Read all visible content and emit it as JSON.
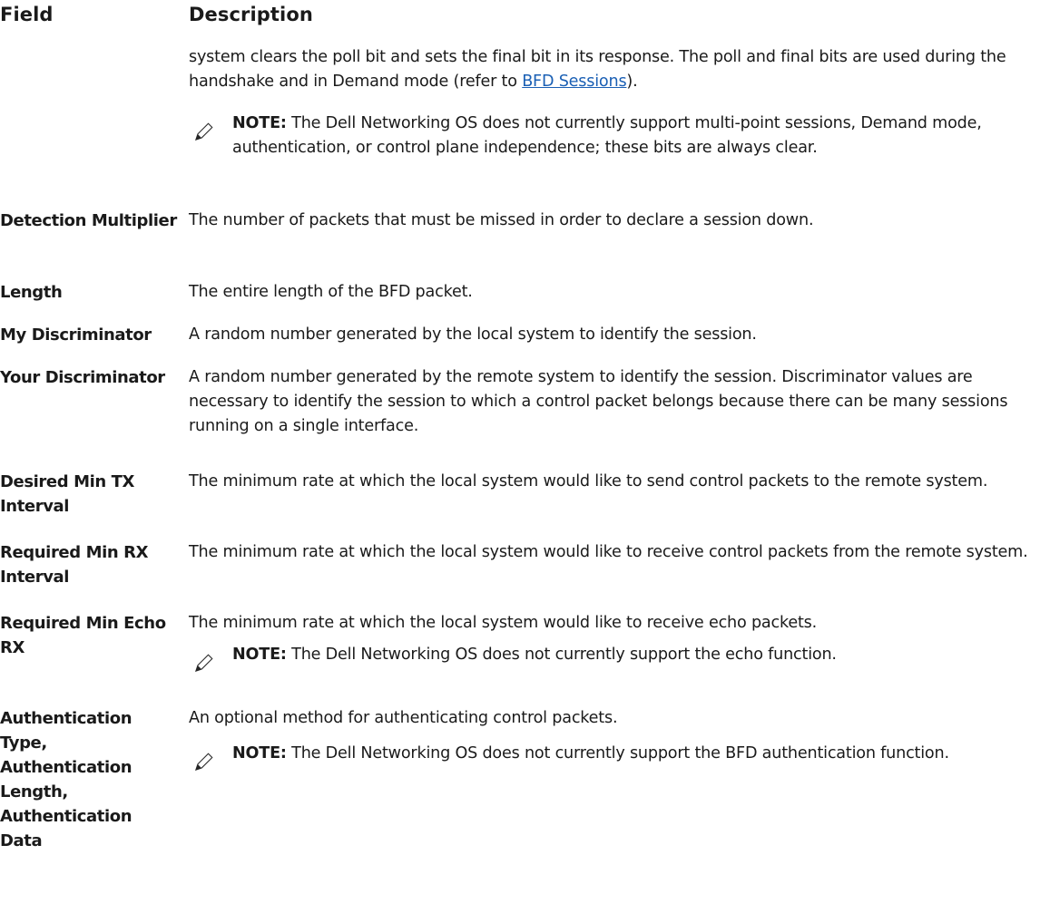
{
  "header": {
    "field": "Field",
    "description": "Description"
  },
  "intro": {
    "text_before_link": "system clears the poll bit and sets the final bit in its response. The poll and final bits are used during the handshake and in Demand mode (refer to ",
    "link": "BFD Sessions",
    "text_after_link": ").",
    "note_label": "NOTE:",
    "note_text": " The Dell Networking OS does not currently support multi-point sessions, Demand mode, authentication, or control plane independence; these bits are always clear."
  },
  "rows": [
    {
      "field": "Detection Multiplier",
      "description": "The number of packets that must be missed in order to declare a session down."
    },
    {
      "field": "Length",
      "description": "The entire length of the BFD packet."
    },
    {
      "field": "My Discriminator",
      "description": "A random number generated by the local system to identify the session."
    },
    {
      "field": "Your Discriminator",
      "description": "A random number generated by the remote system to identify the session. Discriminator values are necessary to identify the session to which a control packet belongs because there can be many sessions running on a single interface."
    },
    {
      "field": "Desired Min TX Interval",
      "description": "The minimum rate at which the local system would like to send control packets to the remote system."
    },
    {
      "field": "Required Min RX Interval",
      "description": "The minimum rate at which the local system would like to receive control packets from the remote system."
    },
    {
      "field": "Required Min Echo RX",
      "description": "The minimum rate at which the local system would like to receive echo packets.",
      "note_label": "NOTE:",
      "note_text": " The Dell Networking OS does not currently support the echo function."
    },
    {
      "field": "Authentication Type, Authentication Length, Authentication Data",
      "description": "An optional method for authenticating control packets.",
      "note_label": "NOTE:",
      "note_text": " The Dell Networking OS does not currently support the BFD authentication function."
    }
  ],
  "icons": {
    "note": "pencil-note-icon"
  },
  "colors": {
    "link": "#1a5fb4",
    "text": "#1a1a1a"
  }
}
